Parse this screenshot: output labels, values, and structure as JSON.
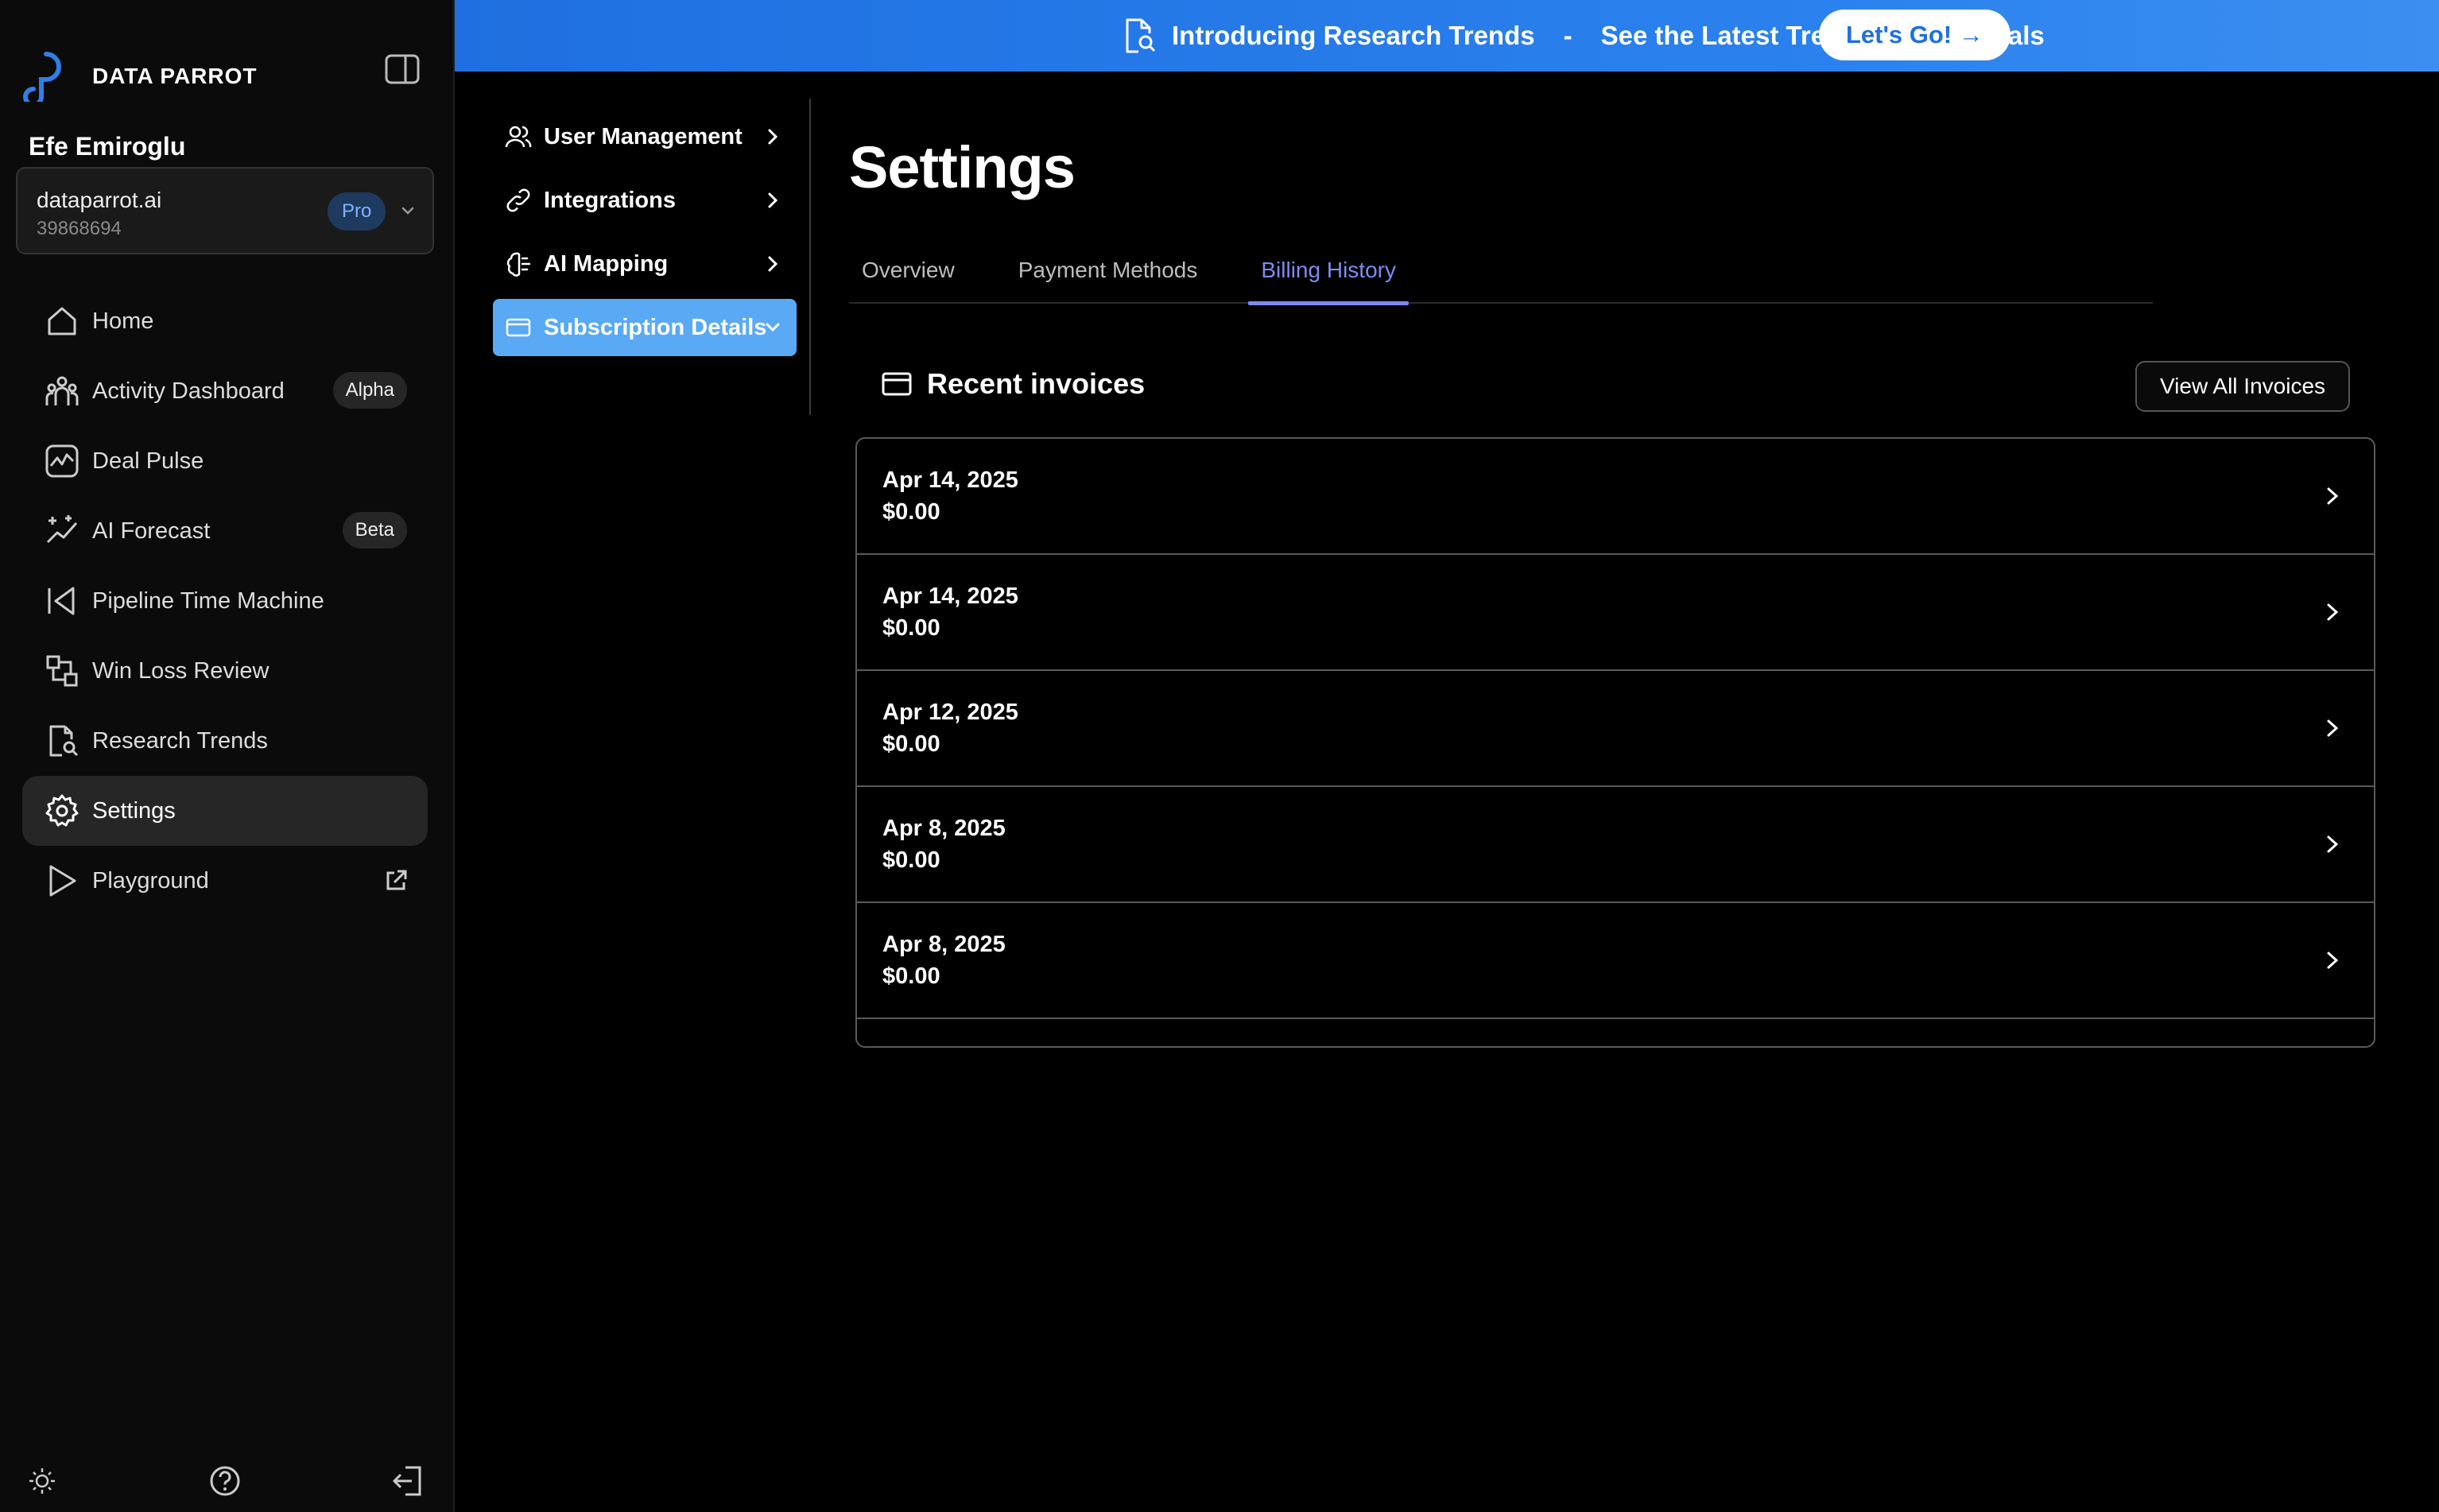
{
  "brand": {
    "name": "DATA PARROT"
  },
  "user": {
    "name": "Efe Emiroglu"
  },
  "org": {
    "name": "dataparrot.ai",
    "id": "39868694",
    "plan": "Pro"
  },
  "sidebar": {
    "items": [
      {
        "label": "Home",
        "icon": "home-icon"
      },
      {
        "label": "Activity Dashboard",
        "icon": "people-icon",
        "badge": "Alpha"
      },
      {
        "label": "Deal Pulse",
        "icon": "pulse-icon"
      },
      {
        "label": "AI Forecast",
        "icon": "sparkle-chart-icon",
        "badge": "Beta"
      },
      {
        "label": "Pipeline Time Machine",
        "icon": "rewind-icon"
      },
      {
        "label": "Win Loss Review",
        "icon": "flow-icon"
      },
      {
        "label": "Research Trends",
        "icon": "doc-search-icon"
      },
      {
        "label": "Settings",
        "icon": "gear-icon",
        "active": true
      },
      {
        "label": "Playground",
        "icon": "play-icon",
        "external": true
      }
    ]
  },
  "banner": {
    "title": "Introducing Research Trends",
    "separator": "-",
    "subtitle": "See the Latest Trends in Your Deals",
    "cta": "Let's Go! →"
  },
  "settings_nav": {
    "items": [
      {
        "label": "User Management",
        "icon": "users-icon"
      },
      {
        "label": "Integrations",
        "icon": "link-icon"
      },
      {
        "label": "AI Mapping",
        "icon": "brain-icon"
      },
      {
        "label": "Subscription Details",
        "icon": "card-icon",
        "active": true
      }
    ]
  },
  "page": {
    "title": "Settings"
  },
  "tabs": [
    {
      "label": "Overview"
    },
    {
      "label": "Payment Methods"
    },
    {
      "label": "Billing History",
      "active": true
    }
  ],
  "invoices": {
    "title": "Recent invoices",
    "view_all": "View All Invoices",
    "rows": [
      {
        "date": "Apr 14, 2025",
        "amount": "$0.00"
      },
      {
        "date": "Apr 14, 2025",
        "amount": "$0.00"
      },
      {
        "date": "Apr 12, 2025",
        "amount": "$0.00"
      },
      {
        "date": "Apr 8, 2025",
        "amount": "$0.00"
      },
      {
        "date": "Apr 8, 2025",
        "amount": "$0.00"
      }
    ]
  },
  "colors": {
    "accent": "#7c8cf0",
    "banner": "#2b82ee",
    "active_subnav": "#5aa9f4",
    "plan_badge": "#1e3a5f"
  }
}
